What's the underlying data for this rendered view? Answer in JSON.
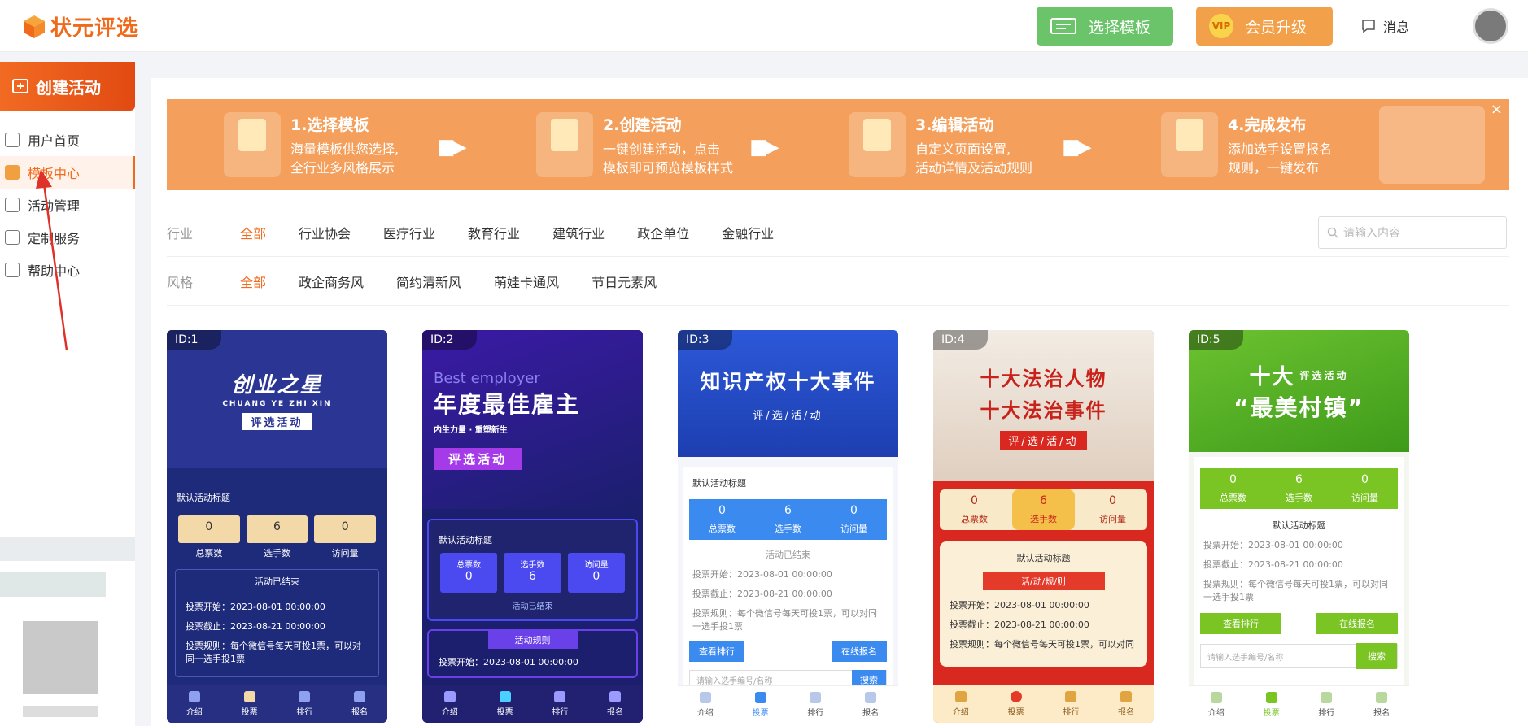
{
  "header": {
    "logo": "状元评选",
    "select_template": "选择模板",
    "vip_badge": "VIP",
    "vip_upgrade": "会员升级",
    "messages": "消息"
  },
  "sidebar": {
    "create": "创建活动",
    "items": [
      {
        "label": "用户首页"
      },
      {
        "label": "模板中心"
      },
      {
        "label": "活动管理"
      },
      {
        "label": "定制服务"
      },
      {
        "label": "帮助中心"
      }
    ]
  },
  "banner": {
    "steps": [
      {
        "title": "1.选择模板",
        "line1": "海量模板供您选择,",
        "line2": "全行业多风格展示"
      },
      {
        "title": "2.创建活动",
        "line1": "一键创建活动，点击",
        "line2": "模板即可预览模板样式"
      },
      {
        "title": "3.编辑活动",
        "line1": "自定义页面设置,",
        "line2": "活动详情及活动规则"
      },
      {
        "title": "4.完成发布",
        "line1": "添加选手设置报名",
        "line2": "规则，一键发布"
      }
    ],
    "close": "×"
  },
  "filters": {
    "industry_label": "行业",
    "industry": [
      "全部",
      "行业协会",
      "医疗行业",
      "教育行业",
      "建筑行业",
      "政企单位",
      "金融行业"
    ],
    "style_label": "风格",
    "style": [
      "全部",
      "政企商务风",
      "简约清新风",
      "萌娃卡通风",
      "节日元素风"
    ],
    "search_placeholder": "请输入内容"
  },
  "cards": [
    {
      "id": "ID:1",
      "t1": "创业之星",
      "sub": "CHUANG YE ZHI XIN",
      "t2": "评选活动",
      "title": "默认活动标题",
      "stats": [
        {
          "n": "0",
          "l": "总票数"
        },
        {
          "n": "6",
          "l": "选手数"
        },
        {
          "n": "0",
          "l": "访问量"
        }
      ],
      "status": "活动已结束",
      "r1": "投票开始：2023-08-01 00:00:00",
      "r2": "投票截止：2023-08-21 00:00:00",
      "r3": "投票规则：每个微信号每天可投1票，可以对同一选手投1票",
      "nav": [
        "介绍",
        "投票",
        "排行",
        "报名"
      ],
      "colors": {
        "bg": "#1e2a7a",
        "hero": "#2a3594",
        "accent": "#f3d9a8",
        "nav": "#262f82",
        "txt": "#fff"
      }
    },
    {
      "id": "ID:2",
      "t1": "年度最佳雇主",
      "sub": "Best employer",
      "t2": "评选活动",
      "tag": "内生力量 · 重塑新生",
      "title": "默认活动标题",
      "stats": [
        {
          "n": "0",
          "l": "总票数"
        },
        {
          "n": "6",
          "l": "选手数"
        },
        {
          "n": "0",
          "l": "访问量"
        }
      ],
      "status": "活动已结束",
      "rule": "活动规则",
      "r1": "投票开始：2023-08-01 00:00:00",
      "nav": [
        "介绍",
        "投票",
        "排行",
        "报名"
      ],
      "colors": {
        "bg": "#1b1f6e",
        "hero": "#3b1aa6",
        "accent": "#4a4af0",
        "nav": "#222070",
        "txt": "#fff"
      }
    },
    {
      "id": "ID:3",
      "t1": "知识产权十大事件",
      "t2": "评/选/活/动",
      "title": "默认活动标题",
      "stats": [
        {
          "n": "0",
          "l": "总票数"
        },
        {
          "n": "6",
          "l": "选手数"
        },
        {
          "n": "0",
          "l": "访问量"
        }
      ],
      "status": "活动已结束",
      "r1": "投票开始：2023-08-01 00:00:00",
      "r2": "投票截止：2023-08-21 00:00:00",
      "r3": "投票规则：每个微信号每天可投1票，可以对同一选手投1票",
      "b1": "查看排行",
      "b2": "在线报名",
      "s_ph": "请输入选手编号/名称",
      "s_btn": "搜索",
      "nav": [
        "介绍",
        "投票",
        "排行",
        "报名"
      ],
      "colors": {
        "bg": "#f4f6fb",
        "hero": "#2c58d8",
        "accent": "#3b8af0",
        "nav": "#fff",
        "txt": "#333"
      }
    },
    {
      "id": "ID:4",
      "t1": "十大法治人物",
      "t1b": "十大法治事件",
      "t2": "评/选/活/动",
      "title": "默认活动标题",
      "stats": [
        {
          "n": "0",
          "l": "总票数"
        },
        {
          "n": "6",
          "l": "选手数"
        },
        {
          "n": "0",
          "l": "访问量"
        }
      ],
      "rule": "活/动/规/则",
      "r1": "投票开始：2023-08-01 00:00:00",
      "r2": "投票截止：2023-08-21 00:00:00",
      "r3": "投票规则：每个微信号每天可投1票，可以对同",
      "nav": [
        "介绍",
        "投票",
        "排行",
        "报名"
      ],
      "colors": {
        "bg": "#d8281f",
        "hero": "#e9e2d8",
        "accent": "#f8e9c8",
        "nav": "#fcebc6",
        "txt": "#b32a1a"
      }
    },
    {
      "id": "ID:5",
      "t1": "十大",
      "t1b": "“最美村镇”",
      "t2": "评选活动",
      "title": "默认活动标题",
      "stats": [
        {
          "n": "0",
          "l": "总票数"
        },
        {
          "n": "6",
          "l": "选手数"
        },
        {
          "n": "0",
          "l": "访问量"
        }
      ],
      "r1": "投票开始：2023-08-01 00:00:00",
      "r2": "投票截止：2023-08-21 00:00:00",
      "r3": "投票规则：每个微信号每天可投1票，可以对同一选手投1票",
      "b1": "查看排行",
      "b2": "在线报名",
      "s_ph": "请输入选手编号/名称",
      "s_btn": "搜索",
      "nav": [
        "介绍",
        "投票",
        "排行",
        "报名"
      ],
      "colors": {
        "bg": "#f4f6f0",
        "hero": "#6cc330",
        "accent": "#7ac424",
        "nav": "#fff",
        "txt": "#333"
      }
    }
  ]
}
